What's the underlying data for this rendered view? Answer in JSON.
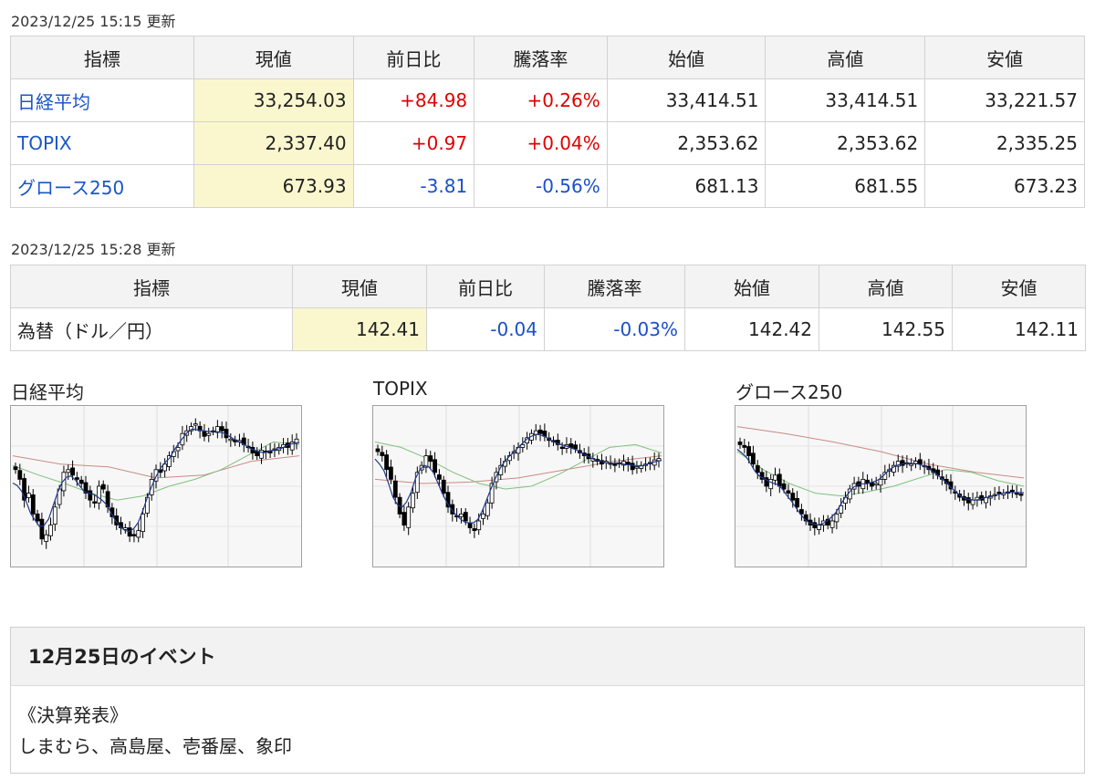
{
  "domestic": {
    "updated": "2023/12/25 15:15 更新",
    "headers": [
      "指標",
      "現値",
      "前日比",
      "騰落率",
      "始値",
      "高値",
      "安値"
    ],
    "rows": [
      {
        "name": "日経平均",
        "current": "33,254.03",
        "change": "+84.98",
        "pct": "+0.26%",
        "open": "33,414.51",
        "high": "33,414.51",
        "low": "33,221.57",
        "direction": "up"
      },
      {
        "name": "TOPIX",
        "current": "2,337.40",
        "change": "+0.97",
        "pct": "+0.04%",
        "open": "2,353.62",
        "high": "2,353.62",
        "low": "2,335.25",
        "direction": "up"
      },
      {
        "name": "グロース250",
        "current": "673.93",
        "change": "-3.81",
        "pct": "-0.56%",
        "open": "681.13",
        "high": "681.55",
        "low": "673.23",
        "direction": "down"
      }
    ]
  },
  "forex": {
    "updated": "2023/12/25 15:28 更新",
    "headers": [
      "指標",
      "現値",
      "前日比",
      "騰落率",
      "始値",
      "高値",
      "安値"
    ],
    "rows": [
      {
        "name": "為替（ドル／円）",
        "current": "142.41",
        "change": "-0.04",
        "pct": "-0.03%",
        "open": "142.42",
        "high": "142.55",
        "low": "142.11",
        "direction": "down"
      }
    ]
  },
  "colors": {
    "up": "#e00000",
    "down": "#1a4fcc",
    "link": "#1a56c8",
    "highlight": "#faf7cf",
    "ma_short": "#1f3a8a",
    "ma_mid": "#7fc17f",
    "ma_long": "#c98a82"
  },
  "charts": {
    "nikkei_title": "日経平均",
    "topix_title": "TOPIX",
    "growth_title": "グロース250"
  },
  "chart_data": [
    {
      "type": "candlestick",
      "title": "日経平均",
      "series": [
        {
          "name": "price",
          "values": [
            0.62,
            0.55,
            0.4,
            0.45,
            0.3,
            0.25,
            0.12,
            0.15,
            0.22,
            0.35,
            0.48,
            0.6,
            0.62,
            0.58,
            0.55,
            0.52,
            0.45,
            0.4,
            0.38,
            0.5,
            0.48,
            0.35,
            0.28,
            0.22,
            0.2,
            0.2,
            0.14,
            0.15,
            0.18,
            0.3,
            0.42,
            0.55,
            0.62,
            0.6,
            0.66,
            0.72,
            0.75,
            0.78,
            0.88,
            0.9,
            0.93,
            0.95,
            0.9,
            0.86,
            0.88,
            0.9,
            0.93,
            0.9,
            0.85,
            0.84,
            0.82,
            0.83,
            0.8,
            0.78,
            0.74,
            0.72,
            0.76,
            0.75,
            0.74,
            0.77,
            0.78,
            0.8,
            0.78,
            0.82,
            0.84
          ]
        },
        {
          "name": "ma_long",
          "values": [
            0.72,
            0.66,
            0.64,
            0.56,
            0.58,
            0.68,
            0.72
          ]
        },
        {
          "name": "ma_mid",
          "values": [
            0.65,
            0.58,
            0.52,
            0.45,
            0.4,
            0.43,
            0.5,
            0.55,
            0.62,
            0.72,
            0.82,
            0.8
          ]
        }
      ]
    },
    {
      "type": "candlestick",
      "title": "TOPIX",
      "series": [
        {
          "name": "price",
          "values": [
            0.75,
            0.72,
            0.62,
            0.55,
            0.42,
            0.3,
            0.22,
            0.35,
            0.45,
            0.6,
            0.65,
            0.72,
            0.68,
            0.6,
            0.55,
            0.45,
            0.35,
            0.3,
            0.28,
            0.3,
            0.25,
            0.2,
            0.18,
            0.25,
            0.3,
            0.38,
            0.52,
            0.6,
            0.65,
            0.68,
            0.72,
            0.75,
            0.78,
            0.8,
            0.85,
            0.88,
            0.9,
            0.88,
            0.86,
            0.83,
            0.82,
            0.8,
            0.78,
            0.8,
            0.78,
            0.77,
            0.74,
            0.72,
            0.7,
            0.7,
            0.68,
            0.66,
            0.68,
            0.66,
            0.65,
            0.67,
            0.68,
            0.66,
            0.62,
            0.64,
            0.65,
            0.66,
            0.67,
            0.69,
            0.7
          ]
        },
        {
          "name": "ma_long",
          "values": [
            0.55,
            0.52,
            0.53,
            0.56,
            0.62,
            0.68,
            0.72
          ]
        },
        {
          "name": "ma_mid",
          "values": [
            0.82,
            0.78,
            0.7,
            0.6,
            0.52,
            0.48,
            0.5,
            0.58,
            0.68,
            0.78,
            0.8,
            0.74
          ]
        }
      ]
    },
    {
      "type": "candlestick",
      "title": "グロース250",
      "series": [
        {
          "name": "price",
          "values": [
            0.8,
            0.78,
            0.72,
            0.66,
            0.6,
            0.55,
            0.5,
            0.55,
            0.58,
            0.5,
            0.48,
            0.45,
            0.4,
            0.35,
            0.3,
            0.25,
            0.22,
            0.2,
            0.22,
            0.25,
            0.22,
            0.25,
            0.3,
            0.36,
            0.42,
            0.48,
            0.52,
            0.5,
            0.55,
            0.52,
            0.5,
            0.52,
            0.55,
            0.6,
            0.62,
            0.65,
            0.68,
            0.65,
            0.67,
            0.66,
            0.68,
            0.66,
            0.65,
            0.62,
            0.6,
            0.58,
            0.55,
            0.52,
            0.48,
            0.45,
            0.42,
            0.4,
            0.38,
            0.4,
            0.42,
            0.4,
            0.42,
            0.43,
            0.44,
            0.45,
            0.45,
            0.46,
            0.47,
            0.45,
            0.44
          ]
        },
        {
          "name": "ma_long",
          "values": [
            0.93,
            0.88,
            0.82,
            0.75,
            0.66,
            0.6,
            0.56
          ]
        },
        {
          "name": "ma_mid",
          "values": [
            0.75,
            0.62,
            0.52,
            0.45,
            0.43,
            0.46,
            0.5,
            0.56,
            0.62,
            0.6,
            0.54,
            0.5
          ]
        }
      ]
    }
  ],
  "event": {
    "title": "12月25日のイベント",
    "category": "《決算発表》",
    "companies": "しまむら、高島屋、壱番屋、象印"
  }
}
